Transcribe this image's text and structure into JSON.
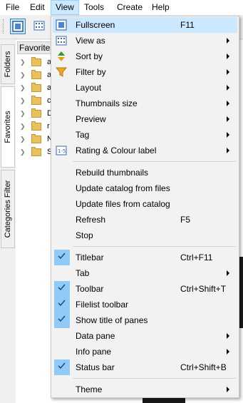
{
  "menubar": {
    "items": [
      "File",
      "Edit",
      "View",
      "Tools",
      "Create",
      "Help"
    ],
    "active": "View"
  },
  "sidebar": {
    "tabs": [
      "Folders",
      "Favorites",
      "Categories Filter"
    ],
    "selected": "Favorites"
  },
  "panel": {
    "tab_label": "Favorites",
    "tree_rows": [
      "a",
      "a",
      "a",
      "c",
      "D",
      "r",
      "N",
      "S"
    ]
  },
  "menu": {
    "items": [
      {
        "label": "Fullscreen",
        "shortcut": "F11",
        "icon": "fullscreen-icon"
      },
      {
        "label": "View as",
        "submenu": true,
        "icon": "grid-view-icon"
      },
      {
        "label": "Sort by",
        "submenu": true,
        "icon": "sort-arrows-icon"
      },
      {
        "label": "Filter by",
        "submenu": true,
        "icon": "funnel-icon"
      },
      {
        "label": "Layout",
        "submenu": true
      },
      {
        "label": "Thumbnails size",
        "submenu": true
      },
      {
        "label": "Preview",
        "submenu": true
      },
      {
        "label": "Tag",
        "submenu": true
      },
      {
        "label": "Rating & Colour label",
        "submenu": true,
        "icon": "rating-icon"
      },
      {
        "label": "Rebuild thumbnails"
      },
      {
        "label": "Update catalog from files"
      },
      {
        "label": "Update files from catalog"
      },
      {
        "label": "Refresh",
        "shortcut": "F5"
      },
      {
        "label": "Stop"
      },
      {
        "label": "Titlebar",
        "shortcut": "Ctrl+F11",
        "checked": true
      },
      {
        "label": "Tab",
        "submenu": true
      },
      {
        "label": "Toolbar",
        "shortcut": "Ctrl+Shift+T",
        "checked": true
      },
      {
        "label": "Filelist toolbar",
        "checked": true
      },
      {
        "label": "Show title of panes",
        "checked": true
      },
      {
        "label": "Data pane",
        "submenu": true
      },
      {
        "label": "Info pane",
        "submenu": true
      },
      {
        "label": "Status bar",
        "shortcut": "Ctrl+Shift+B",
        "checked": true
      },
      {
        "label": "Theme",
        "submenu": true
      }
    ]
  },
  "colors": {
    "highlight": "#cce8ff",
    "check_bg": "#91c9f7",
    "menu_bg": "#f2f2f2"
  }
}
